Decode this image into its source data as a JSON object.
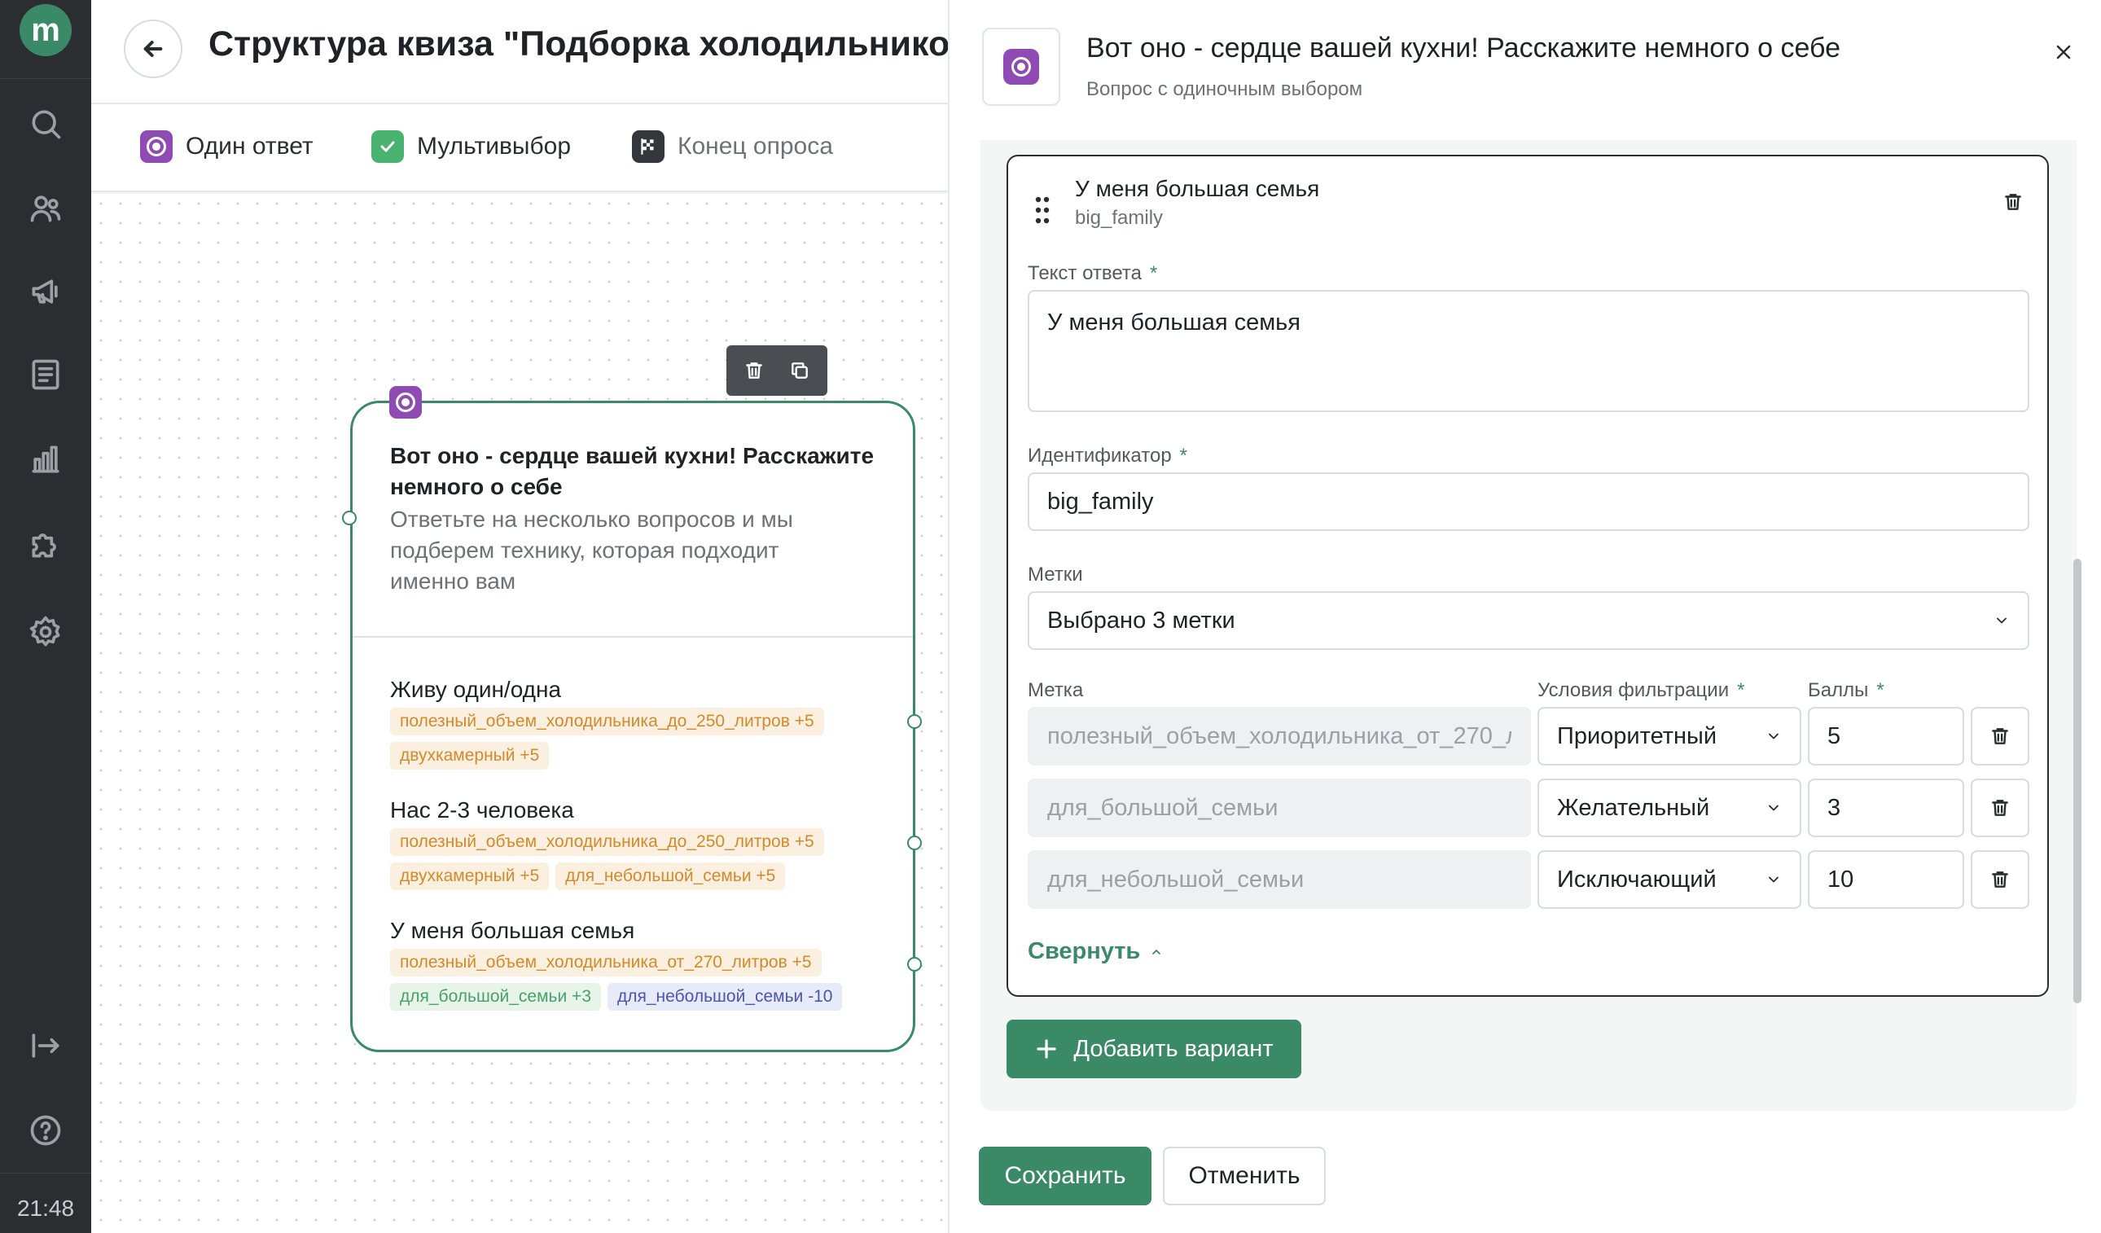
{
  "sidebar": {
    "logo": "m",
    "icons": [
      "search-icon",
      "users-icon",
      "megaphone-icon",
      "document-icon",
      "chart-icon",
      "puzzle-icon",
      "gear-icon"
    ],
    "bottom_icons": [
      "logout-icon",
      "help-icon"
    ],
    "time": "21:48"
  },
  "header": {
    "title": "Структура квиза \"Подборка холодильников\""
  },
  "toolbar": {
    "items": [
      {
        "label": "Один ответ",
        "icon": "single-choice-icon"
      },
      {
        "label": "Мультивыбор",
        "icon": "checkbox-icon"
      },
      {
        "label": "Конец опроса",
        "icon": "finish-flag-icon"
      }
    ]
  },
  "node": {
    "title": "Вот оно - сердце вашей кухни! Расскажите немного о себе",
    "description": "Ответьте на несколько вопросов и мы подберем технику, которая подходит именно вам",
    "answers": [
      {
        "label": "Живу один/одна",
        "tags": [
          {
            "text": "полезный_объем_холодильника_до_250_литров +5",
            "color": "orange"
          },
          {
            "text": "двухкамерный +5",
            "color": "orange"
          }
        ]
      },
      {
        "label": "Нас 2-3 человека",
        "tags": [
          {
            "text": "полезный_объем_холодильника_до_250_литров +5",
            "color": "orange"
          },
          {
            "text": "двухкамерный +5",
            "color": "orange"
          },
          {
            "text": "для_небольшой_семьи +5",
            "color": "orange"
          }
        ]
      },
      {
        "label": "У меня большая семья",
        "tags": [
          {
            "text": "полезный_объем_холодильника_от_270_литров +5",
            "color": "orange"
          },
          {
            "text": "для_большой_семьи +3",
            "color": "green"
          },
          {
            "text": "для_небольшой_семьи -10",
            "color": "blue"
          }
        ]
      }
    ]
  },
  "panel": {
    "title": "Вот оно - сердце вашей кухни! Расскажите немного о себе",
    "subtitle": "Вопрос с одиночным выбором",
    "variant": {
      "title": "У меня большая семья",
      "id": "big_family",
      "answer_text_label": "Текст ответа",
      "answer_text_value": "У меня большая семья",
      "identifier_label": "Идентификатор",
      "identifier_value": "big_family",
      "tags_label": "Метки",
      "tags_value": "Выбрано 3 метки",
      "col_tag": "Метка",
      "col_condition": "Условия фильтрации",
      "col_points": "Баллы",
      "rows": [
        {
          "tag": "полезный_объем_холодильника_от_270_литров",
          "condition": "Приоритетный",
          "points": "5"
        },
        {
          "tag": "для_большой_семьи",
          "condition": "Желательный",
          "points": "3"
        },
        {
          "tag": "для_небольшой_семьи",
          "condition": "Исключающий",
          "points": "10"
        }
      ],
      "collapse_label": "Свернуть"
    },
    "add_variant_label": "Добавить вариант",
    "save_label": "Сохранить",
    "cancel_label": "Отменить"
  },
  "colors": {
    "accent": "#3a8a68",
    "purple": "#8f4bb4",
    "sidebar": "#2b2d30"
  }
}
